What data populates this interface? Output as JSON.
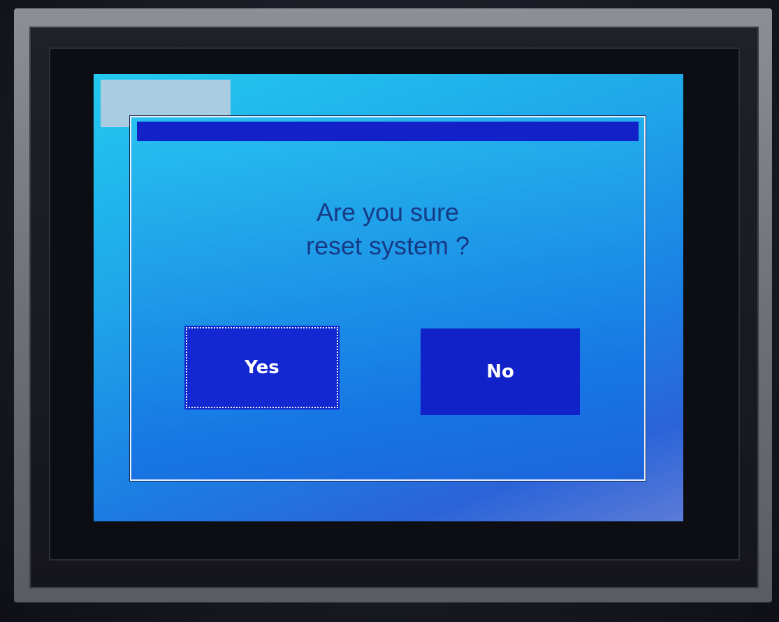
{
  "dialog": {
    "message_line1": "Are you sure",
    "message_line2": "reset system ?",
    "yes_label": "Yes",
    "no_label": "No",
    "focused_button": "Yes"
  },
  "colors": {
    "screen_accent": "#1fa6ea",
    "title_bar": "#1321c9",
    "button_bg": "#1428d2",
    "message_text": "#173a86"
  }
}
